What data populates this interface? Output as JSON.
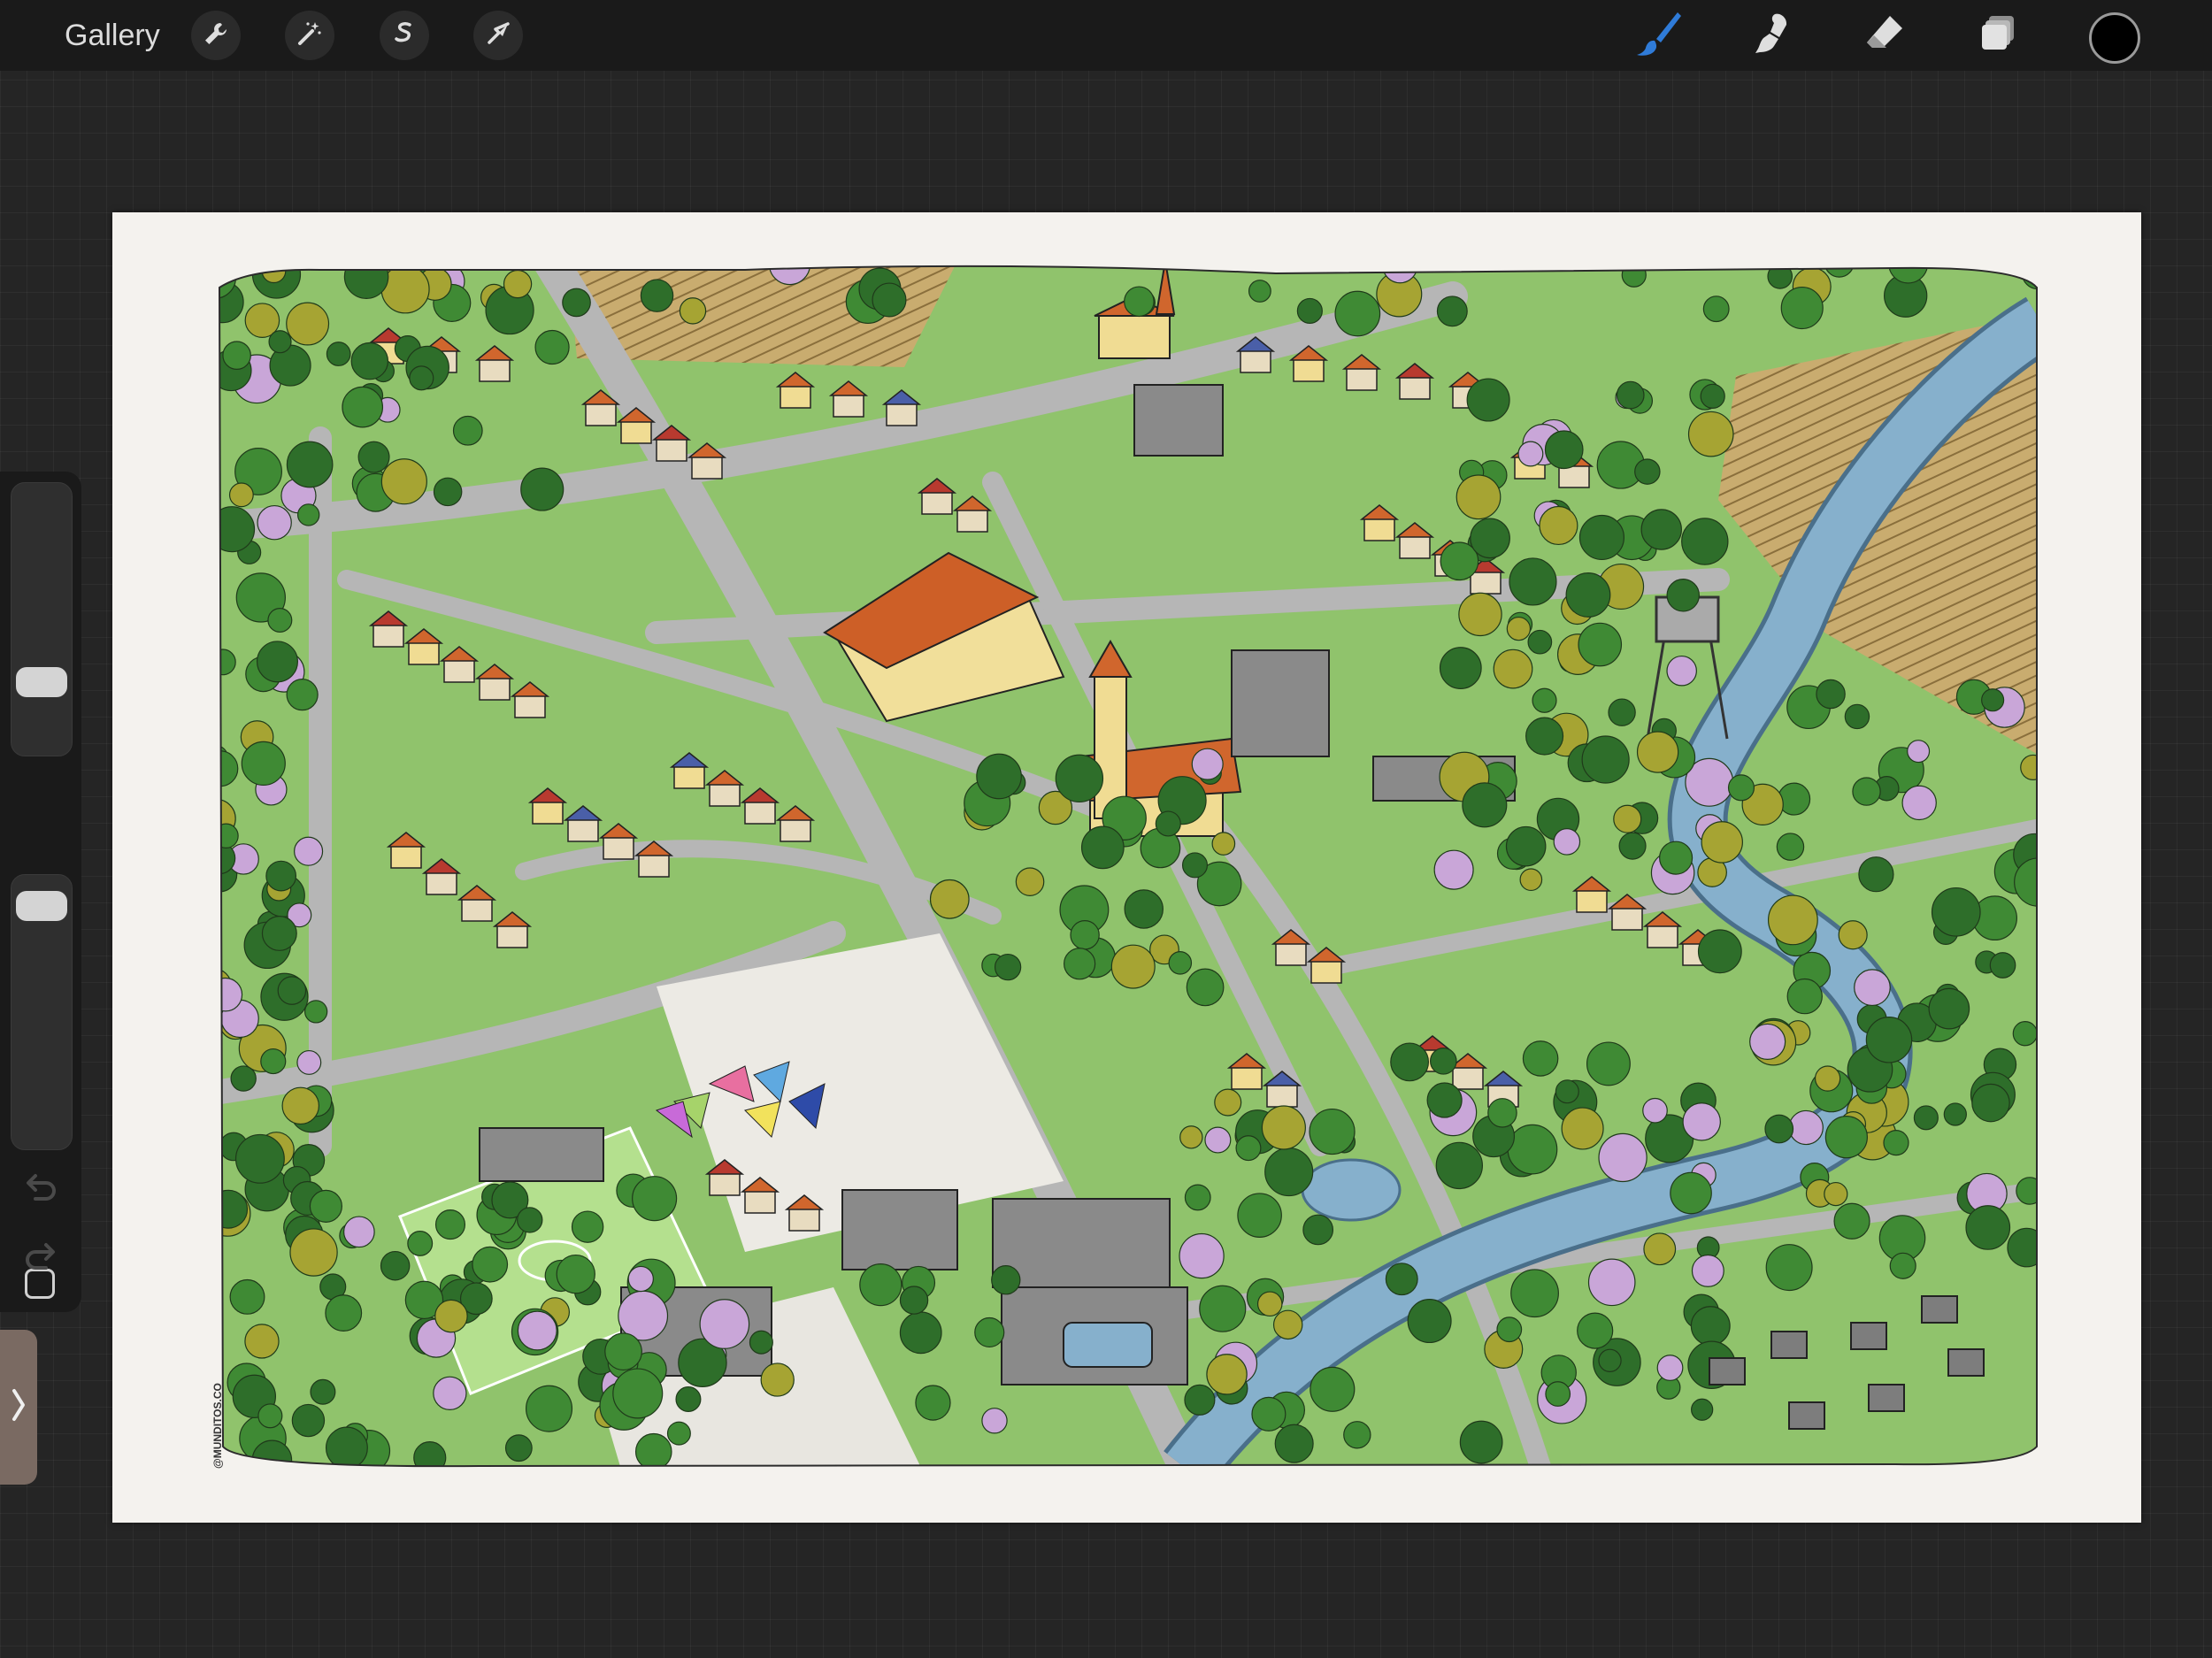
{
  "app": {
    "gallery_label": "Gallery"
  },
  "toolbar": {
    "left_tools": [
      "wrench-icon",
      "magic-wand-icon",
      "selection-icon",
      "transform-arrow-icon"
    ],
    "right_tools": [
      "brush-icon",
      "smudge-icon",
      "eraser-icon",
      "layers-icon"
    ],
    "active_tool": "brush",
    "active_tool_color": "#2f7bd8",
    "current_color": "#000000"
  },
  "sidebar": {
    "brush_size_level": 0.77,
    "opacity_level": 0.05,
    "controls": [
      "brush-size-slider",
      "modify-button",
      "opacity-slider",
      "undo-button",
      "redo-button"
    ]
  },
  "canvas": {
    "paper_color": "#f4f2ee",
    "artwork": "hand-drawn isometric town map",
    "signature": "@MUNDITOS.CO",
    "palette": {
      "grass": "#8cc06a",
      "trees": "#3f8a34",
      "river": "#7fa9c6",
      "roads": "#b3b3b3",
      "roofs": "#d0662d",
      "fields": "#c8a96a",
      "blossoms": "#c9a6d8"
    }
  }
}
